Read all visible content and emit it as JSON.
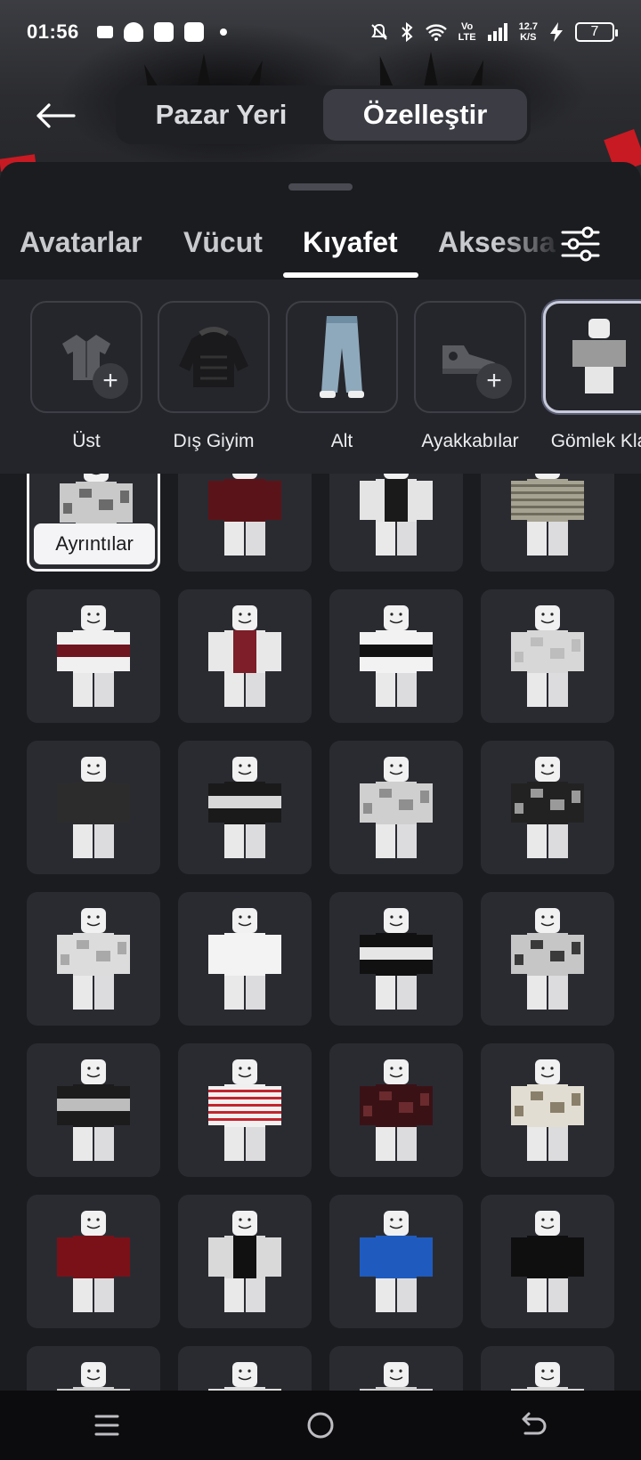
{
  "status_bar": {
    "time": "01:56",
    "network_top": "Vo",
    "network_bottom": "LTE",
    "speed_top": "12.7",
    "speed_bottom": "K/S",
    "battery": "7",
    "icons": [
      "message-icon",
      "snapchat-icon",
      "app-icon",
      "app-icon",
      "dot-icon",
      "mute-icon",
      "bluetooth-icon",
      "wifi-icon",
      "signal-icon",
      "charging-icon",
      "battery-icon"
    ]
  },
  "header": {
    "back_icon": "arrow-left-icon",
    "segments": [
      {
        "label": "Pazar Yeri",
        "active": false
      },
      {
        "label": "Özelleştir",
        "active": true
      }
    ]
  },
  "tabs": [
    {
      "label": "Avatarlar",
      "active": false
    },
    {
      "label": "Vücut",
      "active": false
    },
    {
      "label": "Kıyafet",
      "active": true
    },
    {
      "label": "Aksesua",
      "active": false
    }
  ],
  "filter_icon": "sliders-icon",
  "categories": [
    {
      "label": "Üst",
      "icon": "shirt-icon",
      "has_add": true,
      "selected": false
    },
    {
      "label": "Dış Giyim",
      "icon": "jacket-thumbnail",
      "has_add": false,
      "selected": false
    },
    {
      "label": "Alt",
      "icon": "jeans-thumbnail",
      "has_add": false,
      "selected": false
    },
    {
      "label": "Ayakkabılar",
      "icon": "sneaker-icon",
      "has_add": true,
      "selected": false
    },
    {
      "label": "Gömlek Kla",
      "icon": "shirt-thumbnail",
      "has_add": false,
      "selected": true
    }
  ],
  "details_label": "Ayrıntılar",
  "items": [
    {
      "shirt": "#c9c9c9",
      "accent": "#6b6b6b",
      "pattern": "grunge"
    },
    {
      "shirt": "#5a1419",
      "accent": "#8a2a30",
      "pattern": "plain"
    },
    {
      "shirt": "#e4e4e4",
      "accent": "#1a1a1a",
      "pattern": "vest"
    },
    {
      "shirt": "#a6a392",
      "accent": "#6f6c5d",
      "pattern": "stripes"
    },
    {
      "shirt": "#f0f0f0",
      "accent": "#6e1520",
      "pattern": "band"
    },
    {
      "shirt": "#e8e8e8",
      "accent": "#7d1e28",
      "pattern": "vest"
    },
    {
      "shirt": "#f2f2f2",
      "accent": "#111111",
      "pattern": "band"
    },
    {
      "shirt": "#d7d7d7",
      "accent": "#bdbdbd",
      "pattern": "grunge"
    },
    {
      "shirt": "#2c2c2c",
      "accent": "#4a4a4a",
      "pattern": "plain"
    },
    {
      "shirt": "#1a1a1a",
      "accent": "#d8d8d8",
      "pattern": "band"
    },
    {
      "shirt": "#cfcfcf",
      "accent": "#8f8f8f",
      "pattern": "grunge"
    },
    {
      "shirt": "#222222",
      "accent": "#9a9a9a",
      "pattern": "grunge"
    },
    {
      "shirt": "#dcdcdc",
      "accent": "#a9a9a9",
      "pattern": "grunge"
    },
    {
      "shirt": "#f3f3f3",
      "accent": "#cfcfcf",
      "pattern": "plain"
    },
    {
      "shirt": "#111111",
      "accent": "#e6e6e6",
      "pattern": "band"
    },
    {
      "shirt": "#c6c6c6",
      "accent": "#3a3a3a",
      "pattern": "grunge"
    },
    {
      "shirt": "#1c1c1c",
      "accent": "#bdbdbd",
      "pattern": "band"
    },
    {
      "shirt": "#f0f0f0",
      "accent": "#c2242e",
      "pattern": "stripes"
    },
    {
      "shirt": "#3a1216",
      "accent": "#6a2a2e",
      "pattern": "grunge"
    },
    {
      "shirt": "#e2ddd2",
      "accent": "#8a7f6a",
      "pattern": "grunge"
    },
    {
      "shirt": "#7a1119",
      "accent": "#5a0d13",
      "pattern": "plain"
    },
    {
      "shirt": "#d9d9d9",
      "accent": "#111111",
      "pattern": "vest"
    },
    {
      "shirt": "#1f5bbf",
      "accent": "#ffffff",
      "pattern": "plain"
    },
    {
      "shirt": "#0f0f0f",
      "accent": "#3a3a3a",
      "pattern": "plain"
    },
    {
      "shirt": "#cccccc",
      "accent": "#777777",
      "pattern": "plain"
    },
    {
      "shirt": "#dddddd",
      "accent": "#888888",
      "pattern": "plain"
    },
    {
      "shirt": "#cfcfcf",
      "accent": "#777777",
      "pattern": "plain"
    },
    {
      "shirt": "#d5d5d5",
      "accent": "#888888",
      "pattern": "plain"
    }
  ],
  "navbar": [
    "menu-icon",
    "home-icon",
    "back-icon"
  ]
}
